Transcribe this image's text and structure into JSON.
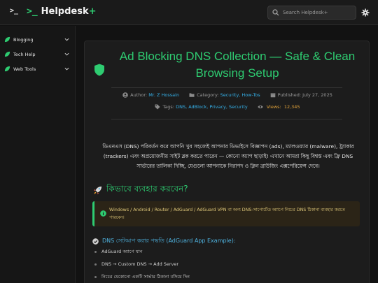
{
  "header": {
    "menu_glyph": ">_",
    "logo_mark": ">_",
    "logo_name": "Helpdesk",
    "logo_plus": "+",
    "search_placeholder": "Search Helpdesk+",
    "theme_icon": "gear-icon"
  },
  "sidebar": {
    "items": [
      {
        "label": "Blogging",
        "icon": "leaf-icon"
      },
      {
        "label": "Tech Help",
        "icon": "leaf-icon"
      },
      {
        "label": "Web Tools",
        "icon": "leaf-icon"
      }
    ]
  },
  "article": {
    "title": "Ad Blocking DNS Collection — Safe & Clean Browsing Setup",
    "meta": {
      "author_label": "Author:",
      "author": "Mr. Z Hossain",
      "category_label": "Category:",
      "category": "Security, How-Tos",
      "published_label": "Published:",
      "published": "July 27, 2025",
      "tags_label": "Tags:",
      "tags": "DNS, AdBlock, Privacy, Security",
      "views_label": "Views:",
      "views": "12,345"
    },
    "intro": "ডিএনএস (DNS) পরিবর্তন করে আপনি খুব সহজেই আপনার ডিভাইসে বিজ্ঞাপন (ads), ম্যালওয়্যার (malware), ট্র্যাকার (trackers) এবং অপ্রয়োজনীয় সাইট ব্লক করতে পারেন — কোনো অ্যাপ ছাড়াই! এখানে আমরা কিছু বিশ্বস্ত এবং ফ্রি DNS সার্ভারের তালিকা দিচ্ছি, যেগুলো আপনাকে নিরাপদ ও ক্লিন ব্রাউজিং এক্সপেরিয়েন্স দেবে।",
    "section_heading": "কিভাবে ব্যবহার করবেন?",
    "notice": "Windows / Android / Router / AdGuard / AdGuard VPN বা অন্য DNS-সাপোর্টেড অ্যাপে নিচের DNS ঠিকানা ব্যবহার করতে পারবেন।",
    "subheading": "DNS সেটআপ করার পদ্ধতি (AdGuard App Example):",
    "steps": [
      "AdGuard অ্যাপে যান",
      "DNS → Custom DNS → Add Server",
      "নিচের যেকোনো একটি সার্ভার ঠিকানা বসিয়ে দিন"
    ]
  },
  "colors": {
    "accent": "#2ecc71",
    "link": "#35b0e8",
    "views": "#e2a33a",
    "notice_bg": "#2b2417"
  }
}
